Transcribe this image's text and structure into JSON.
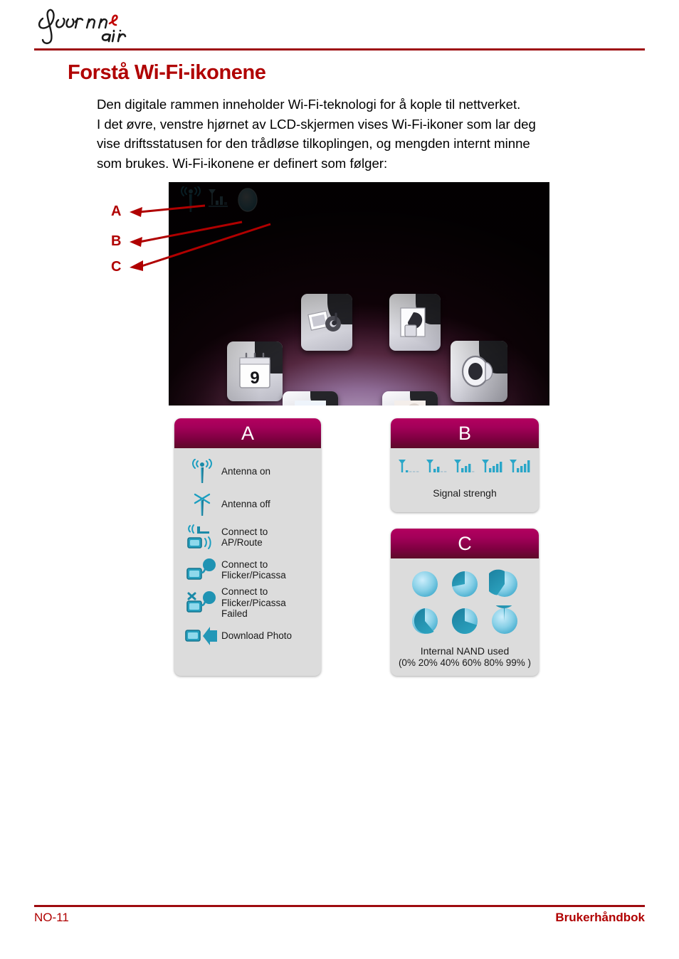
{
  "brand": {
    "name": "Journe",
    "sub": "air",
    "accent_color": "#c00000",
    "ink_color": "#1a1a1a"
  },
  "theme": {
    "rule_color": "#9e0b0f",
    "title_color": "#b00000",
    "panel_header_from": "#b3005f",
    "panel_header_to": "#5c0b28",
    "panel_body_bg": "#dcdcdc",
    "icon_teal": "#1b8aa8",
    "icon_teal_dark": "#0f5f78",
    "icon_cyan": "#56c8e0"
  },
  "header": {
    "title": "Forstå Wi-Fi-ikonene"
  },
  "body": {
    "lines": [
      "Den digitale rammen inneholder Wi-Fi-teknologi for å kople til nettverket.",
      "I det øvre, venstre hjørnet av LCD-skjermen vises Wi-Fi-ikoner som lar deg",
      "vise driftsstatusen for den trådløse tilkoplingen, og mengden internt minne",
      "som brukes. Wi-Fi-ikonene er definert som følger:"
    ]
  },
  "callouts": [
    {
      "label": "A",
      "target": "antenna-icon"
    },
    {
      "label": "B",
      "target": "signal-strength-icon"
    },
    {
      "label": "C",
      "target": "nand-usage-icon"
    }
  ],
  "device_screen": {
    "status_icons": [
      "antenna-on-icon",
      "signal-strength-icon",
      "nand-usage-icon"
    ],
    "carousel_items": [
      {
        "name": "calendar-tile",
        "badge": "9"
      },
      {
        "name": "photo-music-tile",
        "badge": ""
      },
      {
        "name": "file-manager-tile",
        "badge": ""
      },
      {
        "name": "speaker-tile",
        "badge": ""
      },
      {
        "name": "bottom-left-tile",
        "badge": ""
      },
      {
        "name": "bottom-right-tile",
        "badge": ""
      }
    ]
  },
  "panel_a": {
    "title": "A",
    "rows": [
      {
        "icon": "antenna-on-icon",
        "label": "Antenna on"
      },
      {
        "icon": "antenna-off-icon",
        "label": "Antenna off"
      },
      {
        "icon": "connect-ap-icon",
        "label": "Connect to\nAP/Route"
      },
      {
        "icon": "connect-flickr-icon",
        "label": "Connect to\nFlicker/Picassa"
      },
      {
        "icon": "connect-flickr-failed-icon",
        "label": "Connect to\nFlicker/Picassa Failed"
      },
      {
        "icon": "download-photo-icon",
        "label": "Download Photo"
      }
    ]
  },
  "panel_b": {
    "title": "B",
    "caption": "Signal strengh",
    "levels": [
      1,
      2,
      3,
      4,
      5
    ],
    "max_bars": 5
  },
  "panel_c": {
    "title": "C",
    "caption": "Internal NAND used",
    "caption_sub": "(0% 20% 40% 60% 80% 99% )",
    "values": [
      0,
      20,
      40,
      60,
      80,
      99
    ]
  },
  "footer": {
    "page": "NO-11",
    "doc": "Brukerhåndbok"
  }
}
